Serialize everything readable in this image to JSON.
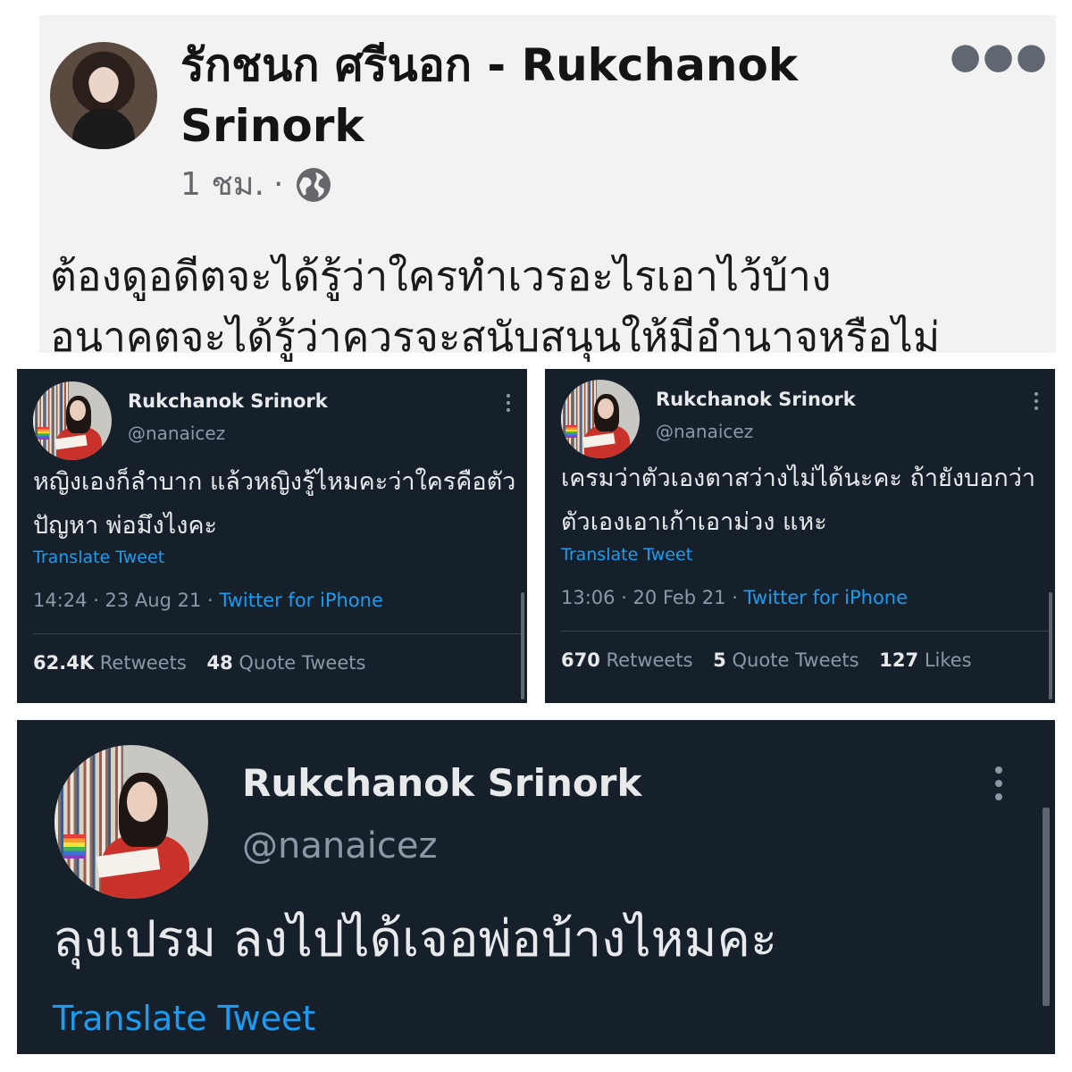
{
  "facebook_post": {
    "author": "รักชนก ศรีนอก - Rukchanok Srinork",
    "time": "1 ชม.",
    "separator": "·",
    "privacy_icon": "globe-icon",
    "more_icon": "more-horizontal-icon",
    "text_line_1": "ต้องดูอดีตจะได้รู้ว่าใครทำเวรอะไรเอาไว้บ้าง",
    "text_line_2": "อนาคตจะได้รู้ว่าควรจะสนับสนุนให้มีอำนาจหรือไม่"
  },
  "tweets": [
    {
      "name": "Rukchanok Srinork",
      "handle": "@nanaicez",
      "text": "หญิงเองก็ลำบาก แล้วหญิงรู้ไหมคะว่าใครคือตัวปัญหา พ่อมึงไงคะ",
      "translate": "Translate Tweet",
      "time": "14:24 · 23 Aug 21 · ",
      "source": "Twitter for iPhone",
      "retweets_count": "62.4K",
      "retweets_label": "Retweets",
      "quotes_count": "48",
      "quotes_label": "Quote Tweets"
    },
    {
      "name": "Rukchanok Srinork",
      "handle": "@nanaicez",
      "text": "เครมว่าตัวเองตาสว่างไม่ได้นะคะ ถ้ายังบอกว่าตัวเองเอาเก้าเอาม่วง แหะ",
      "translate": "Translate Tweet",
      "time": "13:06 · 20 Feb 21 · ",
      "source": "Twitter for iPhone",
      "retweets_count": "670",
      "retweets_label": "Retweets",
      "quotes_count": "5",
      "quotes_label": "Quote Tweets",
      "likes_count": "127",
      "likes_label": "Likes"
    },
    {
      "name": "Rukchanok Srinork",
      "handle": "@nanaicez",
      "text": "ลุงเปรม ลงไปได้เจอพ่อบ้างไหมคะ",
      "translate": "Translate Tweet"
    }
  ],
  "colors": {
    "tweet_background": "#15202b",
    "link_blue": "#1d9bf0",
    "secondary_text": "#8b98a5",
    "facebook_background": "#f2f2f2"
  }
}
